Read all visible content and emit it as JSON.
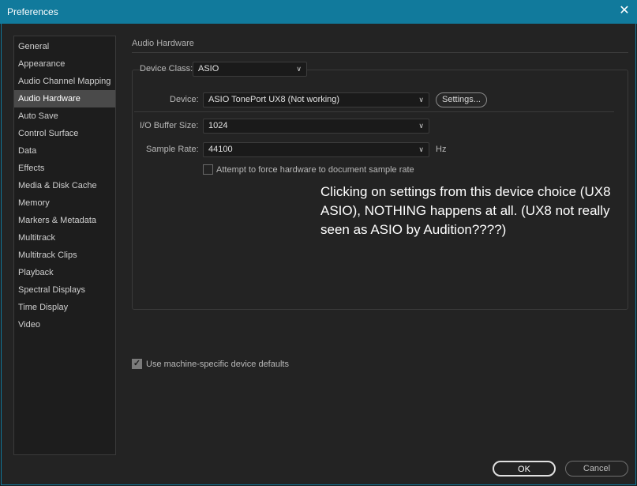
{
  "window": {
    "title": "Preferences"
  },
  "sidebar": {
    "items": [
      {
        "label": "General"
      },
      {
        "label": "Appearance"
      },
      {
        "label": "Audio Channel Mapping"
      },
      {
        "label": "Audio Hardware"
      },
      {
        "label": "Auto Save"
      },
      {
        "label": "Control Surface"
      },
      {
        "label": "Data"
      },
      {
        "label": "Effects"
      },
      {
        "label": "Media & Disk Cache"
      },
      {
        "label": "Memory"
      },
      {
        "label": "Markers & Metadata"
      },
      {
        "label": "Multitrack"
      },
      {
        "label": "Multitrack Clips"
      },
      {
        "label": "Playback"
      },
      {
        "label": "Spectral Displays"
      },
      {
        "label": "Time Display"
      },
      {
        "label": "Video"
      }
    ],
    "selected": "Audio Hardware"
  },
  "audio_hardware": {
    "section_title": "Audio Hardware",
    "device_class": {
      "label": "Device Class:",
      "value": "ASIO"
    },
    "device": {
      "label": "Device:",
      "value": "ASIO TonePort UX8 (Not working)"
    },
    "settings_button": "Settings...",
    "buffer_size": {
      "label": "I/O Buffer Size:",
      "value": "1024"
    },
    "sample_rate": {
      "label": "Sample Rate:",
      "value": "44100",
      "unit": "Hz"
    },
    "force_sample_rate": {
      "label": "Attempt to force hardware to document sample rate",
      "checked": false
    },
    "machine_defaults": {
      "label": "Use machine-specific device defaults",
      "checked": true
    }
  },
  "annotation": "Clicking on settings from this device choice (UX8 ASIO), NOTHING happens at all. (UX8 not really seen as ASIO by Audition????)",
  "footer": {
    "ok_label": "OK",
    "cancel_label": "Cancel"
  },
  "colors": {
    "titlebar": "#117a9c",
    "background": "#232323",
    "selected_item": "#4a4a4a"
  }
}
